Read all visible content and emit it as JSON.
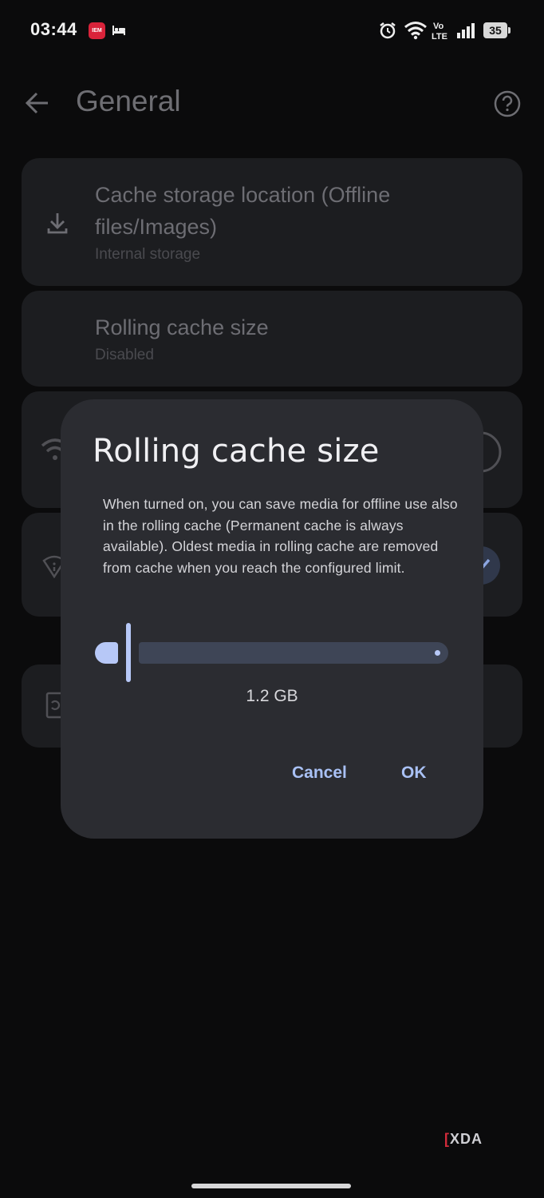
{
  "status_bar": {
    "time": "03:44",
    "notif_badge": "IEM",
    "battery_level": "35",
    "icons": [
      "app-notification-icon",
      "bed-icon",
      "alarm-icon",
      "wifi-icon",
      "volte-icon",
      "signal-icon",
      "battery-icon"
    ]
  },
  "header": {
    "title": "General"
  },
  "settings": {
    "cache_location": {
      "title_line1": "Cache storage location (Offline",
      "title_line2": "files/Images)",
      "subtitle": "Internal storage"
    },
    "rolling_cache": {
      "title": "Rolling cache size",
      "subtitle": "Disabled"
    }
  },
  "dialog": {
    "title": "Rolling cache size",
    "body": "When turned on, you can save media for offline use also in the rolling cache (Permanent cache is always available). Oldest media in rolling cache are removed from cache when you reach the configured limit.",
    "slider_value": "1.2 GB",
    "slider_level": 0.02,
    "cancel_label": "Cancel",
    "ok_label": "OK"
  },
  "watermark": {
    "mark": "[",
    "text": "XDA"
  },
  "colors": {
    "background": "#0b0b0c",
    "dialog_bg": "#2b2c31",
    "accent": "#b7c8f7",
    "button_text": "#a9c1f5",
    "track": "#3e4556"
  }
}
